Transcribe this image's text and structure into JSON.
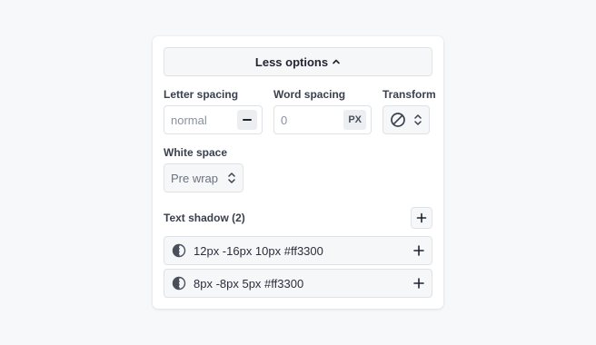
{
  "toggle": {
    "label": "Less options"
  },
  "letter_spacing": {
    "label": "Letter spacing",
    "placeholder": "normal"
  },
  "word_spacing": {
    "label": "Word spacing",
    "placeholder": "0",
    "unit": "PX"
  },
  "transform": {
    "label": "Transform",
    "icon": "no-transform-icon"
  },
  "white_space": {
    "label": "White space",
    "value": "Pre wrap"
  },
  "text_shadow": {
    "title": "Text shadow (2)",
    "items": [
      {
        "value": "12px -16px 10px #ff3300"
      },
      {
        "value": "8px -8px 5px #ff3300"
      }
    ]
  },
  "colors": {
    "border": "#dfe2e8",
    "field_bg": "#f6f7f9",
    "text": "#1f2430"
  }
}
